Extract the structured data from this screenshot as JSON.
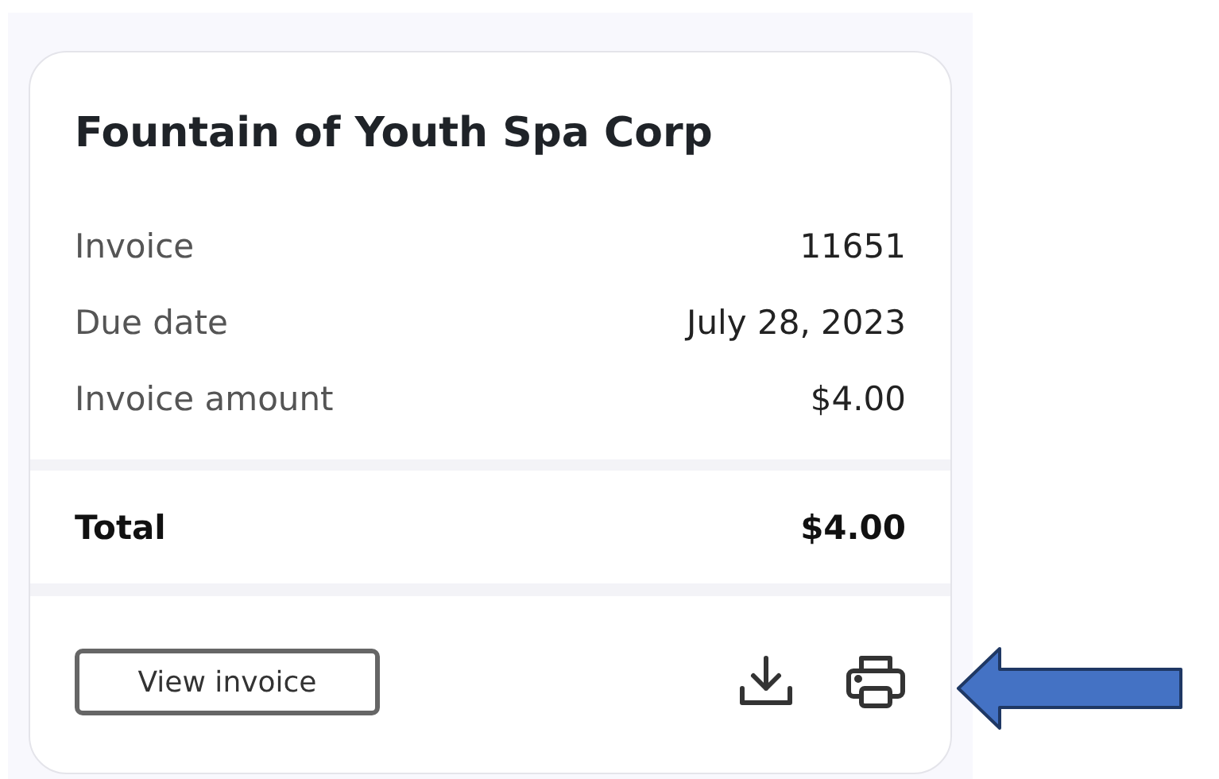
{
  "card": {
    "title": "Fountain of Youth Spa Corp",
    "rows": [
      {
        "label": "Invoice",
        "value": "11651"
      },
      {
        "label": "Due date",
        "value": "July 28, 2023"
      },
      {
        "label": "Invoice amount",
        "value": "$4.00"
      }
    ],
    "total": {
      "label": "Total",
      "value": "$4.00"
    },
    "view_button": "View invoice"
  }
}
